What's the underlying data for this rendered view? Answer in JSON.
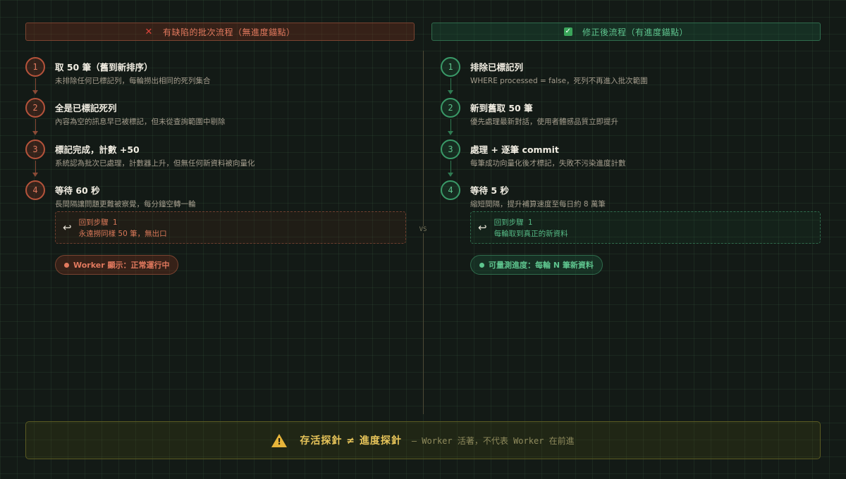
{
  "left": {
    "header": "有缺陷的批次流程（無進度錨點）",
    "steps": [
      {
        "num": "1",
        "title": "取 50 筆（舊到新排序）",
        "desc": "未排除任何已標記列，每輪撈出相同的死列集合"
      },
      {
        "num": "2",
        "title": "全是已標記死列",
        "desc": "內容為空的訊息早已被標記，但未從查詢範圍中剔除"
      },
      {
        "num": "3",
        "title": "標記完成，計數 +50",
        "desc": "系統認為批次已處理，計數器上升，但無任何新資料被向量化"
      },
      {
        "num": "4",
        "title": "等待 60 秒",
        "desc": "長間隔讓問題更難被察覺，每分鐘空轉一輪"
      }
    ],
    "loop": {
      "arrow": "↩",
      "line1": "回到步驟 1",
      "line2": "永遠撈同樣 50 筆，無出口"
    },
    "pill": "Worker 顯示：正常運行中"
  },
  "right": {
    "header": "修正後流程（有進度錨點）",
    "steps": [
      {
        "num": "1",
        "title": "排除已標記列",
        "desc": "WHERE processed = false，死列不再進入批次範圍"
      },
      {
        "num": "2",
        "title": "新到舊取 50 筆",
        "desc": "優先處理最新對話，使用者體感品質立即提升"
      },
      {
        "num": "3",
        "title": "處理 + 逐筆 commit",
        "desc": "每筆成功向量化後才標記，失敗不污染進度計數"
      },
      {
        "num": "4",
        "title": "等待 5 秒",
        "desc": "縮短間隔，提升補算速度至每日約 8 萬筆"
      }
    ],
    "loop": {
      "arrow": "↩",
      "line1": "回到步驟 1",
      "line2": "每輪取到真正的新資料"
    },
    "pill": "可量測進度：每輪 N 筆新資料"
  },
  "vs": "VS",
  "footer": {
    "main": "存活探針 ≠ 進度探針",
    "sub": "— Worker 活著，不代表 Worker 在前進",
    "icon": "warning-icon",
    "icon_glyph": "!"
  },
  "icons": {
    "left_header": "cross-icon",
    "left_header_glyph": "✕",
    "right_header": "checkmark-icon",
    "right_header_glyph": "✓"
  },
  "colors": {
    "bad": "#e2795e",
    "good": "#5ec48e",
    "warning": "#e8c55a",
    "background": "#131a16"
  }
}
